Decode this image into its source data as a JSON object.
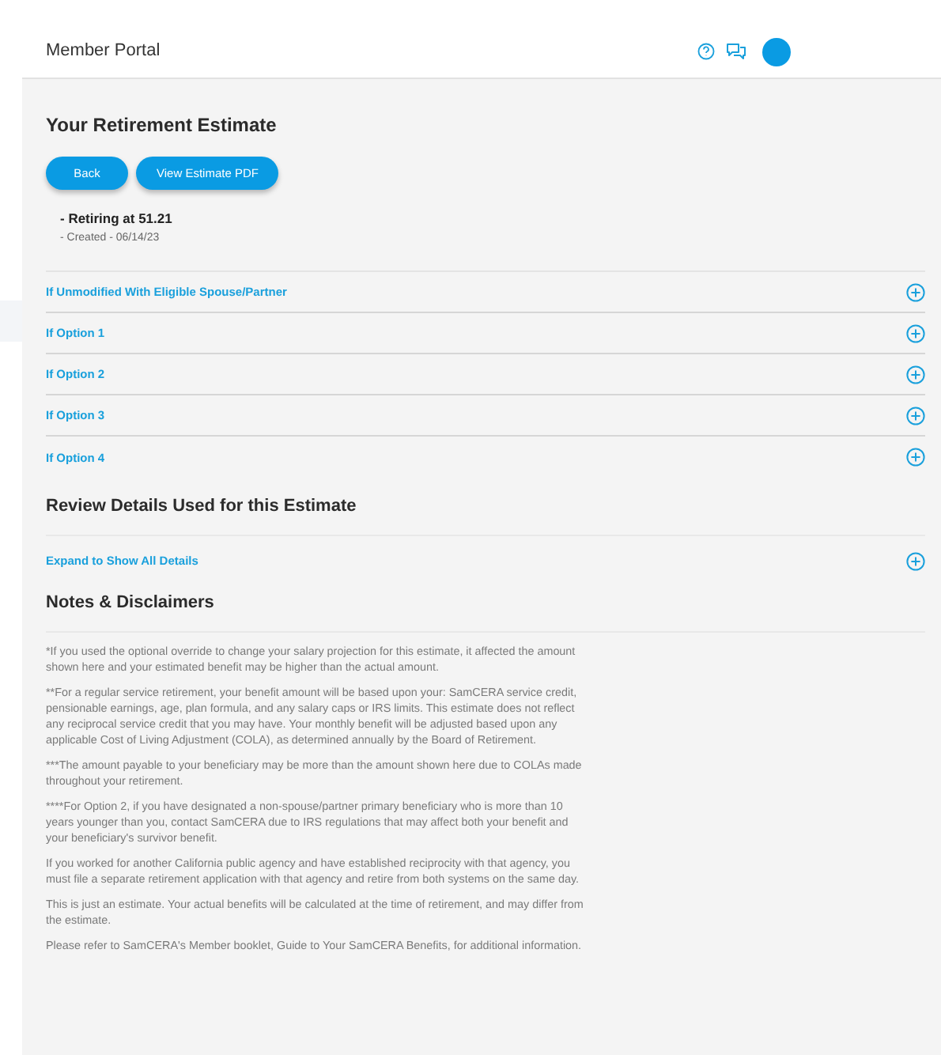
{
  "header": {
    "title": "Member Portal"
  },
  "estimate": {
    "title": "Your Retirement Estimate",
    "buttons": [
      "Back",
      "View Estimate PDF"
    ],
    "retiring": "- Retiring at 51.21",
    "created": "- Created - 06/14/23"
  },
  "options": [
    {
      "label": "If Unmodified With Eligible Spouse/Partner",
      "expanded": false
    },
    {
      "label": "If Option 1",
      "expanded": false
    },
    {
      "label": "If Option 2",
      "expanded": false
    },
    {
      "label": "If Option 3",
      "expanded": false
    },
    {
      "label": "If Option 4",
      "expanded": false
    }
  ],
  "review": {
    "title": "Review Details Used for this Estimate",
    "expand": {
      "label": "Expand to Show All Details",
      "expanded": false
    }
  },
  "notes": {
    "title": "Notes & Disclaimers",
    "paragraphs": [
      "*If you used the optional override to change your salary projection for this estimate, it affected the amount shown here and your estimated benefit may be higher than the actual amount.",
      "**For a regular service retirement, your benefit amount will be based upon your: SamCERA service credit, pensionable earnings, age, plan formula, and any salary caps or IRS limits. This estimate does not reflect any reciprocal service credit that you may have. Your monthly benefit will be adjusted based upon any applicable Cost of Living Adjustment (COLA), as determined annually by the Board of Retirement.",
      "***The amount payable to your beneficiary may be more than the amount shown here due to COLAs made throughout your retirement.",
      "****For Option 2, if you have designated a non-spouse/partner primary beneficiary who is more than 10 years younger than you, contact SamCERA due to IRS regulations that may affect both your benefit and your beneficiary's survivor benefit.",
      "If you worked for another California public agency and have established reciprocity with that agency, you must file a separate retirement application with that agency and retire from both systems on the same day.",
      "This is just an estimate. Your actual benefits will be calculated at the time of retirement, and may differ from the estimate.",
      "Please refer to SamCERA's Member booklet, Guide to Your SamCERA Benefits, for additional information."
    ]
  }
}
